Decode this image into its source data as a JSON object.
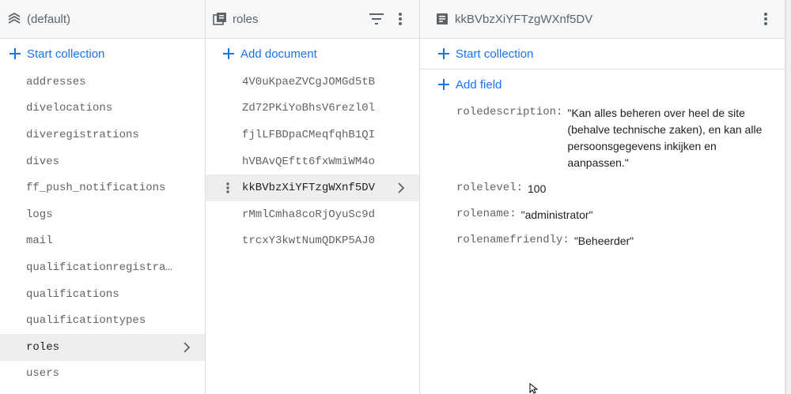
{
  "databases_panel": {
    "title": "(default)",
    "start_collection_label": "Start collection",
    "collections": [
      "addresses",
      "divelocations",
      "diveregistrations",
      "dives",
      "ff_push_notifications",
      "logs",
      "mail",
      "qualificationregistra…",
      "qualifications",
      "qualificationtypes",
      "roles",
      "users"
    ],
    "selected_index": 10
  },
  "collection_panel": {
    "title": "roles",
    "add_document_label": "Add document",
    "documents": [
      "4V0uKpaeZVCgJOMGd5tB",
      "Zd72PKiYoBhsV6rezl0l",
      "fjlLFBDpaCMeqfqhB1QI",
      "hVBAvQEftt6fxWmiWM4o",
      "kkBVbzXiYFTzgWXnf5DV",
      "rMmlCmha8coRjOyuSc9d",
      "trcxY3kwtNumQDKP5AJ0"
    ],
    "selected_index": 4
  },
  "document_panel": {
    "title": "kkBVbzXiYFTzgWXnf5DV",
    "start_collection_label": "Start collection",
    "add_field_label": "Add field",
    "fields": [
      {
        "key": "roledescription:",
        "value": "\"Kan alles beheren over heel de site (behalve technische zaken), en kan alle persoonsgegevens inkijken en aanpassen.\""
      },
      {
        "key": "rolelevel:",
        "value": "100"
      },
      {
        "key": "rolename:",
        "value": "\"administrator\""
      },
      {
        "key": "rolenamefriendly:",
        "value": "\"Beheerder\""
      }
    ]
  },
  "colors": {
    "accent": "#1a73e8",
    "selected_bg": "#eeeeee",
    "header_bg": "#f6f7f8"
  }
}
